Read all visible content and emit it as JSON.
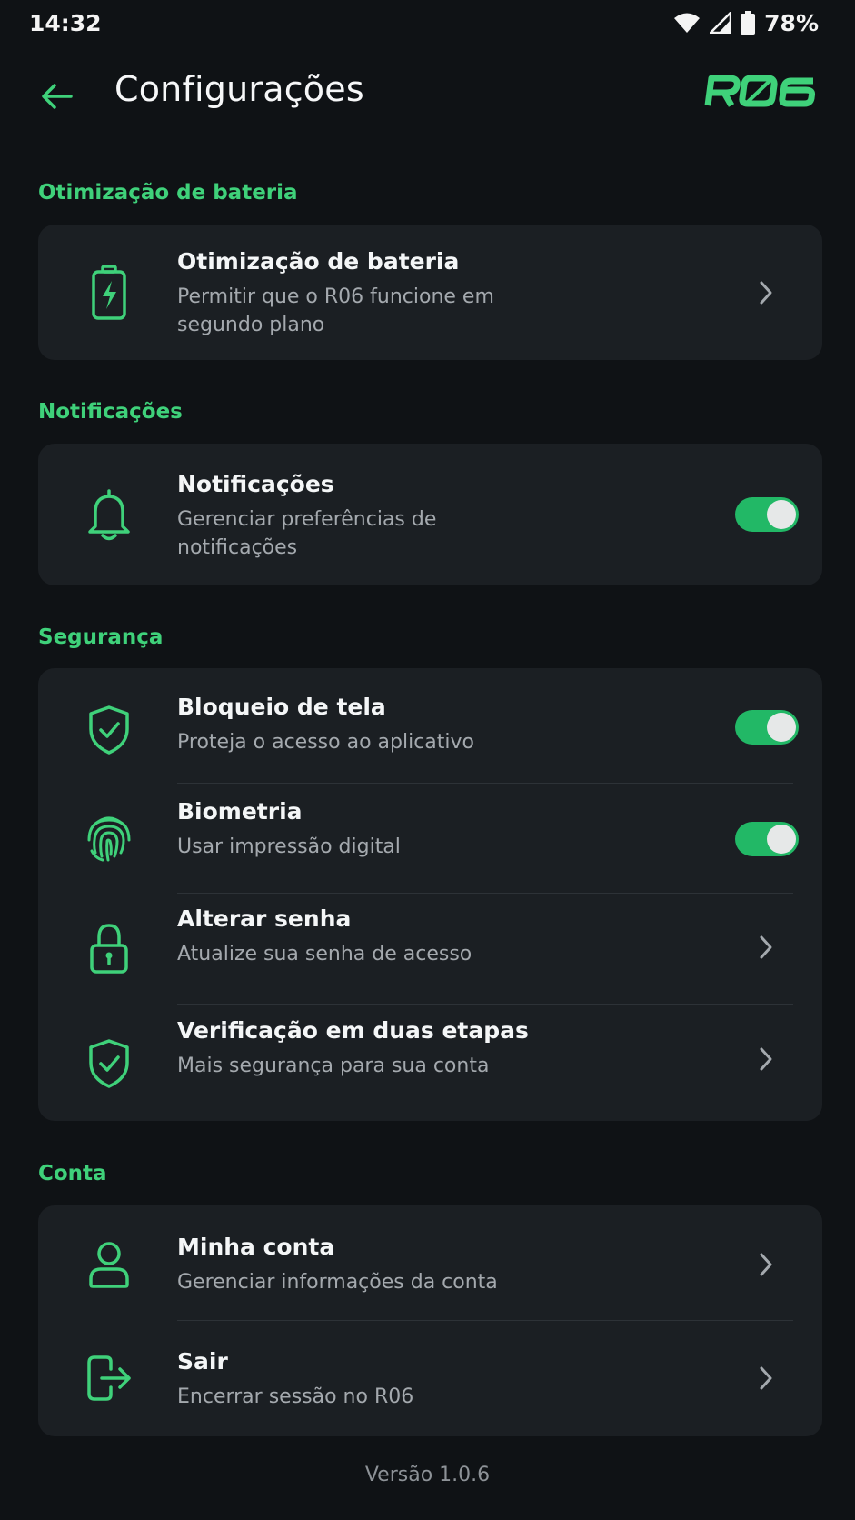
{
  "status_bar": {
    "time": "14:32",
    "battery": "78%",
    "icons": [
      "wifi-icon",
      "signal-icon",
      "battery-icon"
    ]
  },
  "app_bar": {
    "title": "Configurações",
    "brand": "R06",
    "back_icon": "arrow-left-icon"
  },
  "colors": {
    "accent": "#3fd17a",
    "background": "#0f1215",
    "card": "#1b1f23",
    "toggle_on": "#22b866"
  },
  "sections": {
    "battery": {
      "label": "Otimização de bateria",
      "items": [
        {
          "icon": "battery-charging-icon",
          "title": "Otimização de bateria",
          "subtitle": "Permitir que o R06 funcione em segundo plano",
          "control": "chevron"
        }
      ]
    },
    "notifications": {
      "label": "Notificações",
      "items": [
        {
          "icon": "bell-icon",
          "title": "Notificações",
          "subtitle": "Gerenciar preferências de notificações",
          "control": "toggle",
          "checked": true
        }
      ]
    },
    "security": {
      "label": "Segurança",
      "items": [
        {
          "icon": "shield-check-icon",
          "title": "Bloqueio de tela",
          "subtitle": "Proteja o acesso ao aplicativo",
          "control": "toggle",
          "checked": true
        },
        {
          "icon": "fingerprint-icon",
          "title": "Biometria",
          "subtitle": "Usar impressão digital",
          "control": "toggle",
          "checked": true
        },
        {
          "icon": "lock-icon",
          "title": "Alterar senha",
          "subtitle": "Atualize sua senha de acesso",
          "control": "chevron"
        },
        {
          "icon": "shield-check-icon",
          "title": "Verificação em duas etapas",
          "subtitle": "Mais segurança para sua conta",
          "control": "chevron"
        }
      ]
    },
    "account": {
      "label": "Conta",
      "items": [
        {
          "icon": "user-icon",
          "title": "Minha conta",
          "subtitle": "Gerenciar informações da conta",
          "control": "chevron"
        },
        {
          "icon": "logout-icon",
          "title": "Sair",
          "subtitle": "Encerrar sessão no R06",
          "control": "chevron"
        }
      ]
    }
  },
  "footer": {
    "version": "Versão 1.0.6"
  }
}
